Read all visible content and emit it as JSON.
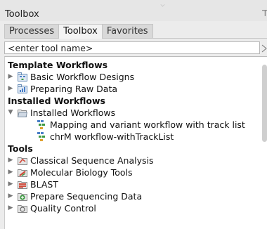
{
  "panel": {
    "title": "Toolbox"
  },
  "tabs": [
    {
      "label": "Processes",
      "active": false
    },
    {
      "label": "Toolbox",
      "active": true
    },
    {
      "label": "Favorites",
      "active": false
    }
  ],
  "search": {
    "placeholder": "<enter tool name>"
  },
  "tree": {
    "template_workflows": {
      "label": "Template Workflows",
      "items": [
        {
          "label": "Basic Workflow Designs",
          "icon": "workflow-folder-icon"
        },
        {
          "label": "Preparing Raw Data",
          "icon": "data-folder-icon"
        }
      ]
    },
    "installed_workflows": {
      "label": "Installed Workflows",
      "folder": {
        "label": "Installed Workflows",
        "expanded": true
      },
      "items": [
        {
          "label": "Mapping and variant workflow with track list",
          "icon": "workflow-icon"
        },
        {
          "label": "chrM workflow-withTrackList",
          "icon": "workflow-icon"
        }
      ]
    },
    "tools": {
      "label": "Tools",
      "items": [
        {
          "label": "Classical Sequence Analysis",
          "icon": "sequence-analysis-icon"
        },
        {
          "label": "Molecular Biology Tools",
          "icon": "molecular-biology-icon"
        },
        {
          "label": "BLAST",
          "icon": "blast-icon"
        },
        {
          "label": "Prepare Sequencing Data",
          "icon": "sequencing-data-icon"
        },
        {
          "label": "Quality Control",
          "icon": "quality-control-icon"
        }
      ]
    }
  },
  "colors": {
    "panel_bg": "#ececec",
    "tree_bg": "#ffffff",
    "folder_blue": "#4a7fc8",
    "tool_red": "#d04a3a",
    "tool_green": "#3f9a44"
  }
}
